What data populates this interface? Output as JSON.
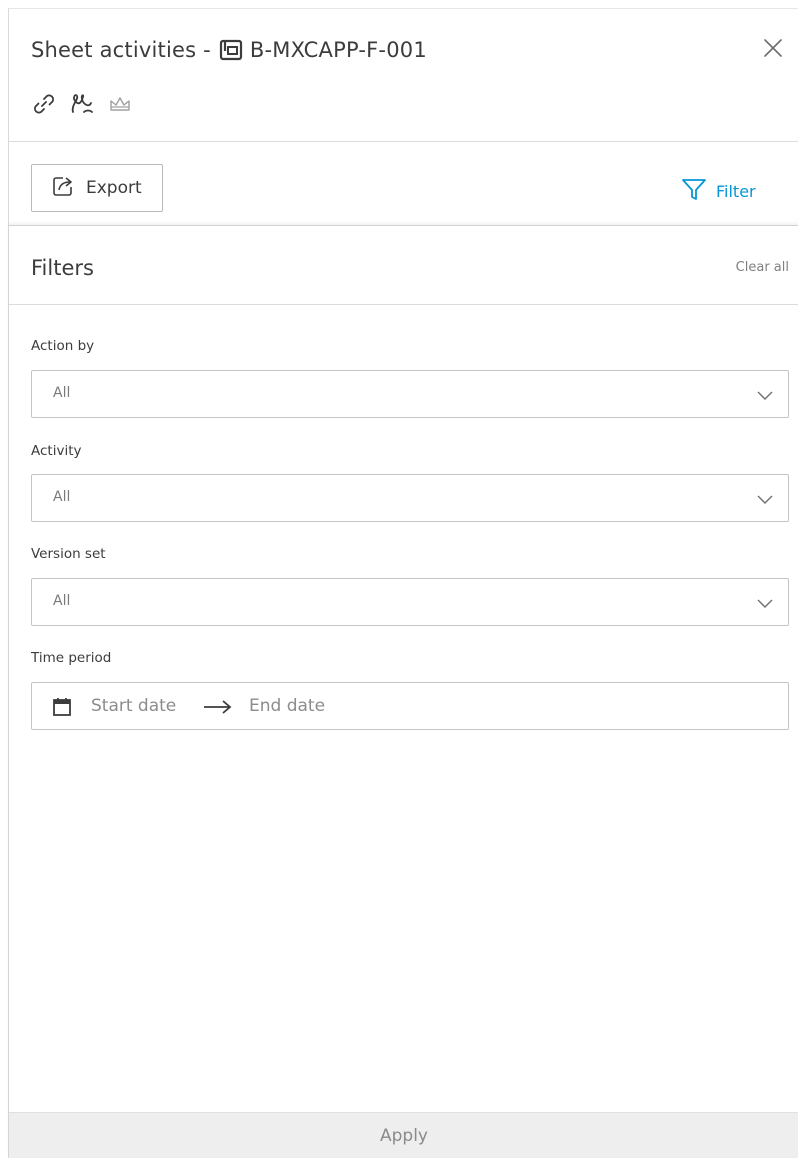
{
  "header": {
    "title_prefix": "Sheet activities -",
    "sheet_name": "B-MXCAPP-F-001",
    "icons": [
      "link-icon",
      "markup-icon",
      "crown-icon"
    ],
    "close_icon": "close-icon"
  },
  "toolbar": {
    "export_label": "Export",
    "filter_label": "Filter"
  },
  "filters": {
    "title": "Filters",
    "clear_all": "Clear all",
    "action_by": {
      "label": "Action by",
      "value": "All"
    },
    "activity": {
      "label": "Activity",
      "value": "All"
    },
    "version_set": {
      "label": "Version set",
      "value": "All"
    },
    "time_period": {
      "label": "Time period",
      "start_placeholder": "Start date",
      "end_placeholder": "End date"
    }
  },
  "footer": {
    "apply_label": "Apply"
  },
  "colors": {
    "accent": "#0696d7",
    "text": "#3c3c3c",
    "muted": "#808080",
    "footer_bg": "#eeeeee"
  }
}
